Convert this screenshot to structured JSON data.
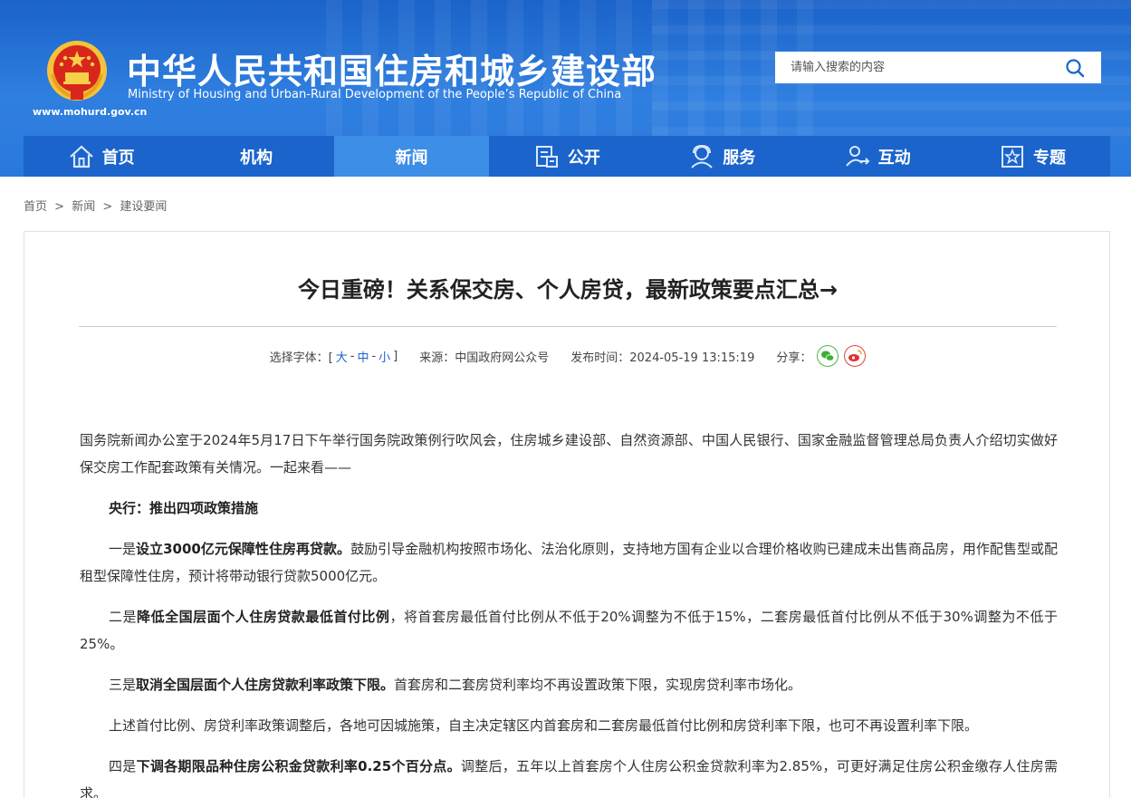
{
  "header": {
    "title": "中华人民共和国住房和城乡建设部",
    "subtitle": "Ministry of Housing and Urban-Rural Development of the People’s Republic of China",
    "url": "www.mohurd.gov.cn",
    "search_placeholder": "请输入搜索的内容"
  },
  "nav": {
    "items": [
      {
        "label": "首页",
        "icon": "home-icon"
      },
      {
        "label": "机构",
        "icon": ""
      },
      {
        "label": "新闻",
        "icon": "",
        "active": true
      },
      {
        "label": "公开",
        "icon": "document-icon"
      },
      {
        "label": "服务",
        "icon": "service-icon"
      },
      {
        "label": "互动",
        "icon": "interaction-icon"
      },
      {
        "label": "专题",
        "icon": "star-icon"
      }
    ]
  },
  "breadcrumb": {
    "items": [
      "首页",
      "新闻",
      "建设要闻"
    ],
    "separator": ">"
  },
  "article": {
    "title": "今日重磅！关系保交房、个人房贷，最新政策要点汇总→",
    "meta": {
      "font_label": "选择字体：[",
      "font_large": "大",
      "font_medium": "中",
      "font_small": "小",
      "font_dash": "-",
      "font_close": "]",
      "source": "来源：中国政府网公众号",
      "published": "发布时间：2024-05-19 13:15:19",
      "share_label": "分享："
    },
    "paragraphs": {
      "p1": "国务院新闻办公室于2024年5月17日下午举行国务院政策例行吹风会，住房城乡建设部、自然资源部、中国人民银行、国家金融监督管理总局负责人介绍切实做好保交房工作配套政策有关情况。一起来看——",
      "p2": "央行：推出四项政策措施",
      "p3_a": "一是",
      "p3_b": "设立3000亿元保障性住房再贷款。",
      "p3_c": "鼓励引导金融机构按照市场化、法治化原则，支持地方国有企业以合理价格收购已建成未出售商品房，用作配售型或配租型保障性住房，预计将带动银行贷款5000亿元。",
      "p4_a": "二是",
      "p4_b": "降低全国层面个人住房贷款最低首付比例",
      "p4_c": "，将首套房最低首付比例从不低于20%调整为不低于15%，二套房最低首付比例从不低于30%调整为不低于25%。",
      "p5_a": "三是",
      "p5_b": "取消全国层面个人住房贷款利率政策下限。",
      "p5_c": "首套房和二套房贷利率均不再设置政策下限，实现房贷利率市场化。",
      "p6": "上述首付比例、房贷利率政策调整后，各地可因城施策，自主决定辖区内首套房和二套房最低首付比例和房贷利率下限，也可不再设置利率下限。",
      "p7_a": "四是",
      "p7_b": "下调各期限品种住房公积金贷款利率0.25个百分点。",
      "p7_c": "调整后，五年以上首套房个人住房公积金贷款利率为2.85%，可更好满足住房公积金缴存人住房需求。"
    }
  },
  "colors": {
    "header_blue": "#1b63c9",
    "nav_blue": "#1a64cc",
    "nav_active": "#3c8ee6",
    "link_blue": "#1a64cc",
    "wechat_green": "#3cb034",
    "weibo_red": "#e0332e"
  }
}
